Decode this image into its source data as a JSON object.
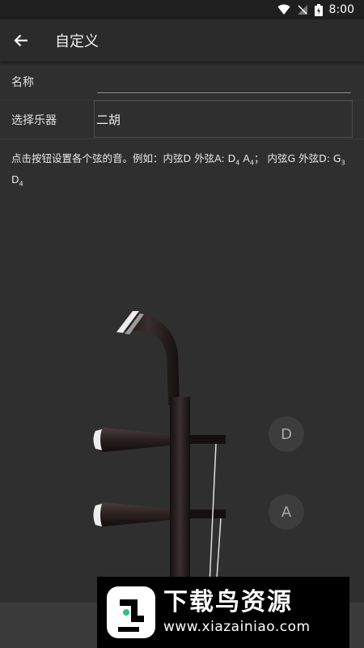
{
  "status_bar": {
    "time": "8:00"
  },
  "app_bar": {
    "title": "自定义"
  },
  "form": {
    "name_label": "名称",
    "name_value": "",
    "instrument_label": "选择乐器",
    "instrument_value": "二胡"
  },
  "hint": {
    "part1": "点击按钮设置各个弦的音。例如：内弦D 外弦A: D",
    "sub1": "4",
    "part2": "  A",
    "sub2": "4",
    "part3": "；  内弦G 外弦D: G",
    "sub3": "3",
    "part4": "  D",
    "sub4": "4"
  },
  "string_buttons": {
    "inner": "D",
    "outer": "A"
  },
  "watermark": {
    "name": "下载鸟资源",
    "url": "www.xiazainiao.com"
  }
}
